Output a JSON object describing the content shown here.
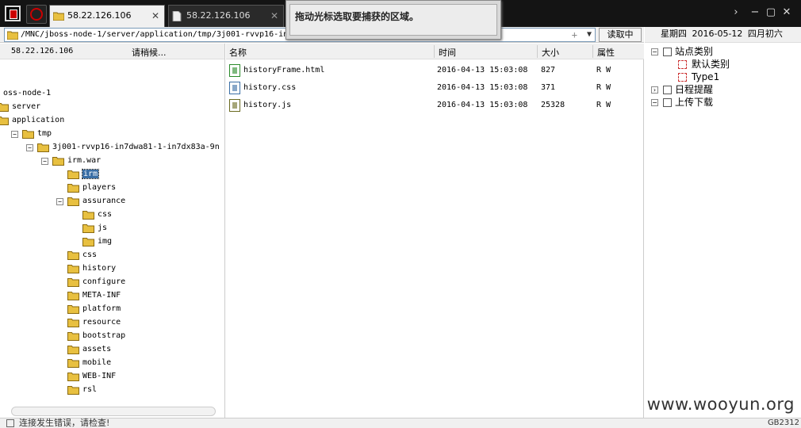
{
  "tabs": [
    {
      "label": "58.22.126.106",
      "active": true
    },
    {
      "label": "58.22.126.106",
      "active": false
    }
  ],
  "tooltip": "拖动光标选取要捕获的区域。",
  "address": {
    "path": "/MNC/jboss-node-1/server/application/tmp/3j001-rvvp16-in7dwa81-1-in7dx83a-9n/irm.war/irm/",
    "read_button": "读取中"
  },
  "left_panel": {
    "ip": "58.22.126.106",
    "status": "请稍候..."
  },
  "tree": [
    {
      "label": "oss-node-1",
      "indent": 0,
      "expander": "",
      "folder": false
    },
    {
      "label": "server",
      "indent": 0,
      "expander": "",
      "folder": true
    },
    {
      "label": "application",
      "indent": 0,
      "expander": "",
      "folder": true
    },
    {
      "label": "tmp",
      "indent": 1,
      "expander": "−",
      "folder": true
    },
    {
      "label": "3j001-rvvp16-in7dwa81-1-in7dx83a-9n",
      "indent": 2,
      "expander": "−",
      "folder": true
    },
    {
      "label": "irm.war",
      "indent": 3,
      "expander": "−",
      "folder": true
    },
    {
      "label": "irm",
      "indent": 4,
      "expander": "",
      "folder": true,
      "selected": true
    },
    {
      "label": "players",
      "indent": 4,
      "expander": "",
      "folder": true
    },
    {
      "label": "assurance",
      "indent": 4,
      "expander": "−",
      "folder": true
    },
    {
      "label": "css",
      "indent": 5,
      "expander": "",
      "folder": true
    },
    {
      "label": "js",
      "indent": 5,
      "expander": "",
      "folder": true
    },
    {
      "label": "img",
      "indent": 5,
      "expander": "",
      "folder": true
    },
    {
      "label": "css",
      "indent": 4,
      "expander": "",
      "folder": true
    },
    {
      "label": "history",
      "indent": 4,
      "expander": "",
      "folder": true
    },
    {
      "label": "configure",
      "indent": 4,
      "expander": "",
      "folder": true
    },
    {
      "label": "META-INF",
      "indent": 4,
      "expander": "",
      "folder": true
    },
    {
      "label": "platform",
      "indent": 4,
      "expander": "",
      "folder": true
    },
    {
      "label": "resource",
      "indent": 4,
      "expander": "",
      "folder": true
    },
    {
      "label": "bootstrap",
      "indent": 4,
      "expander": "",
      "folder": true
    },
    {
      "label": "assets",
      "indent": 4,
      "expander": "",
      "folder": true
    },
    {
      "label": "mobile",
      "indent": 4,
      "expander": "",
      "folder": true
    },
    {
      "label": "WEB-INF",
      "indent": 4,
      "expander": "",
      "folder": true
    },
    {
      "label": "rsl",
      "indent": 4,
      "expander": "",
      "folder": true
    }
  ],
  "file_list": {
    "columns": {
      "name": "名称",
      "time": "时间",
      "size": "大小",
      "attr": "属性"
    },
    "rows": [
      {
        "name": "historyFrame.html",
        "time": "2016-04-13 15:03:08",
        "size": "827",
        "attr": "R W",
        "icon": "html-file-icon",
        "icon_color": "#2a8a2a"
      },
      {
        "name": "history.css",
        "time": "2016-04-13 15:03:08",
        "size": "371",
        "attr": "R W",
        "icon": "css-file-icon",
        "icon_color": "#3a6ea5"
      },
      {
        "name": "history.js",
        "time": "2016-04-13 15:03:08",
        "size": "25328",
        "attr": "R W",
        "icon": "js-file-icon",
        "icon_color": "#6a6a20"
      }
    ]
  },
  "right_panel": {
    "date": "星期四 2016-05-12 四月初六",
    "tree": [
      {
        "label": "站点类别",
        "kind": "expander",
        "symbol": "−",
        "indent": 0
      },
      {
        "label": "默认类别",
        "kind": "box",
        "indent": 1
      },
      {
        "label": "Type1",
        "kind": "box",
        "indent": 1
      },
      {
        "label": "日程提醒",
        "kind": "expander",
        "symbol": "›",
        "indent": 0
      },
      {
        "label": "上传下载",
        "kind": "expander",
        "symbol": "−",
        "indent": 0
      }
    ]
  },
  "status": {
    "message": "连接发生错误，请检查!",
    "encoding": "GB2312"
  },
  "watermark": "www.wooyun.org",
  "colors": {
    "tab_bar": "#141414",
    "selection": "#3a6ea5",
    "folder": "#e8c040"
  }
}
